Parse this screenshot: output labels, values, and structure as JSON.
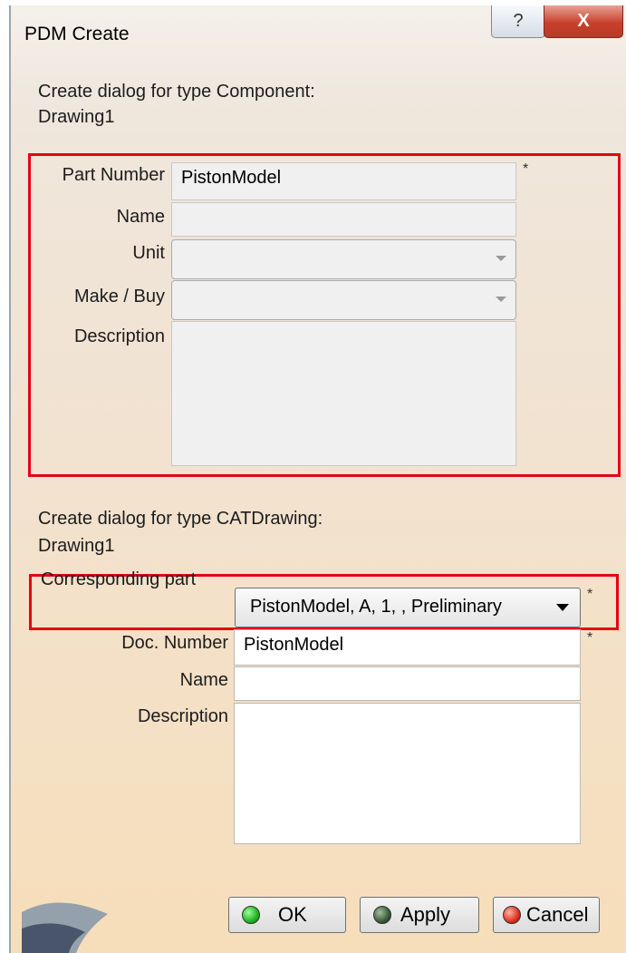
{
  "window": {
    "title": "PDM Create",
    "help_glyph": "?",
    "close_glyph": "X"
  },
  "section1": {
    "heading": "Create dialog for type Component:",
    "subheading": "Drawing1",
    "fields": {
      "part_number_label": "Part Number",
      "part_number_value": "PistonModel",
      "name_label": "Name",
      "unit_label": "Unit",
      "make_buy_label": "Make / Buy",
      "description_label": "Description"
    },
    "required_mark": "*"
  },
  "section2": {
    "heading": "Create dialog for type CATDrawing:",
    "subheading": "Drawing1",
    "corresponding_label": "Corresponding part",
    "corresponding_value": "PistonModel, A, 1, , Preliminary",
    "doc_number_label": "Doc. Number",
    "doc_number_value": "PistonModel",
    "name_label": "Name",
    "description_label": "Description",
    "required_mark": "*"
  },
  "buttons": {
    "ok": "OK",
    "apply": "Apply",
    "cancel": "Cancel"
  },
  "colors": {
    "highlight": "#e30613",
    "ok_dot": "#1fb51f",
    "apply_dot": "#2f4f2f",
    "cancel_dot": "#e03020"
  }
}
